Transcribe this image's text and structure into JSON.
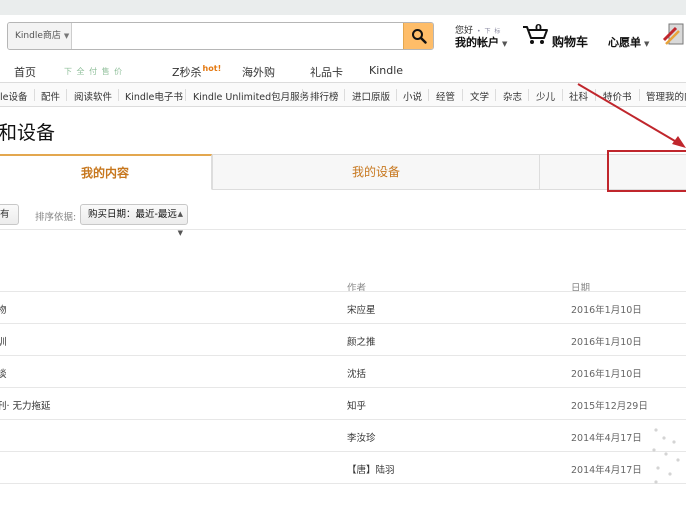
{
  "header": {
    "search": {
      "department": "Kindle商店",
      "value": "",
      "placeholder": ""
    },
    "hello_label": "您好",
    "hello_name": "• 下 标",
    "account_label": "我的帐户",
    "cart_count": "0",
    "cart_label": "购物车",
    "wishlist_label": "心愿单"
  },
  "nav_primary": [
    {
      "label": "首页"
    },
    {
      "label": "下 全 付 售 价"
    },
    {
      "label": "Z秒杀",
      "badge": "hot!"
    },
    {
      "label": "海外购"
    },
    {
      "label": "礼品卡"
    },
    {
      "label": "Kindle"
    }
  ],
  "nav_secondary": [
    "le设备",
    "配件",
    "阅读软件",
    "Kindle电子书",
    "Kindle Unlimited包月服务",
    "排行榜",
    "进口原版",
    "小说",
    "经管",
    "文学",
    "杂志",
    "少儿",
    "社科",
    "特价书",
    "管理我的内"
  ],
  "page": {
    "title": "和设备"
  },
  "tabs": [
    {
      "label": "我的内容",
      "active": true
    },
    {
      "label": "我的设备",
      "active": false
    },
    {
      "label": "",
      "active": false
    }
  ],
  "sort": {
    "filter_value": "有",
    "label": "排序依据:",
    "value": "购买日期：最近-最远"
  },
  "table": {
    "headers": {
      "title": "",
      "author": "作者",
      "date": "日期"
    },
    "rows": [
      {
        "title": "物",
        "author": "宋应星",
        "date": "2016年1月10日"
      },
      {
        "title": "训",
        "author": "颜之推",
        "date": "2016年1月10日"
      },
      {
        "title": "谈",
        "author": "沈括",
        "date": "2016年1月10日"
      },
      {
        "title": "刊· 无力拖延",
        "author": "知乎",
        "date": "2015年12月29日"
      },
      {
        "title": "",
        "author": "李汝珍",
        "date": "2014年4月17日"
      },
      {
        "title": "",
        "author": "【唐】陆羽",
        "date": "2014年4月17日"
      }
    ]
  },
  "colors": {
    "accent": "#febd69",
    "tab_text": "#c7771e",
    "highlight_box": "#c0262c"
  }
}
